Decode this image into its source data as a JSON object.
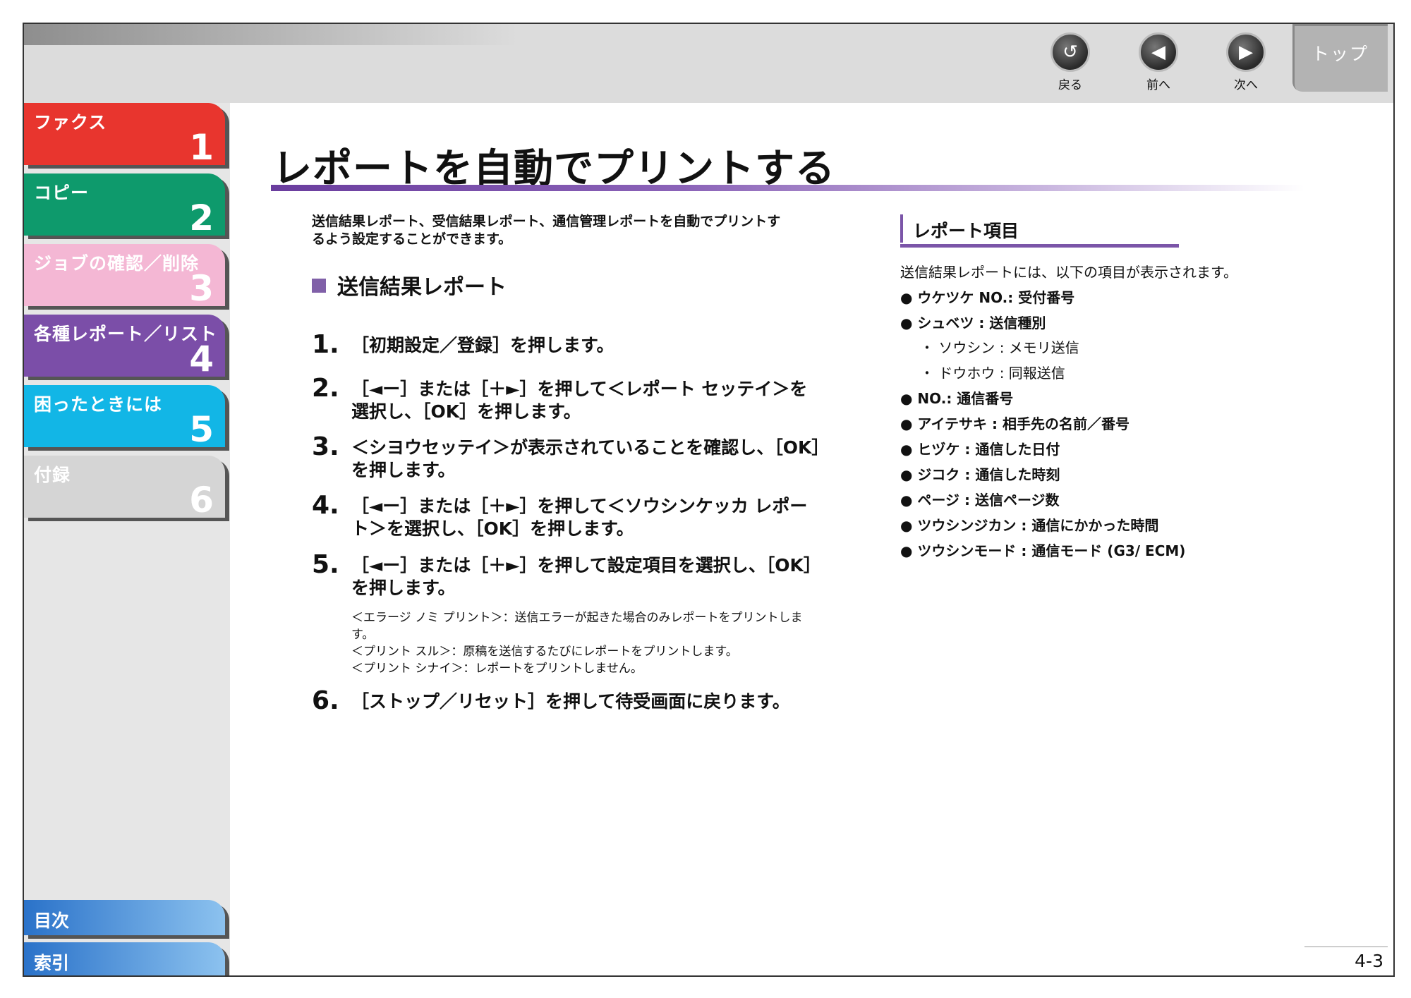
{
  "nav": {
    "back_label": "戻る",
    "prev_label": "前へ",
    "next_label": "次へ",
    "top_label": "トップ"
  },
  "sidebar": {
    "tabs": [
      {
        "label": "ファクス",
        "num": "1",
        "color": "#e8352e"
      },
      {
        "label": "コピー",
        "num": "2",
        "color": "#0e9a6c"
      },
      {
        "label": "ジョブの確認／削除",
        "num": "3",
        "color": "#f4b7d4"
      },
      {
        "label": "各種レポート／リスト",
        "num": "4",
        "color": "#7b4ea8"
      },
      {
        "label": "困ったときには",
        "num": "5",
        "color": "#12b6e6"
      },
      {
        "label": "付録",
        "num": "6",
        "color": "#d5d5d5"
      }
    ],
    "contents_label": "目次",
    "index_label": "索引"
  },
  "page": {
    "title": "レポートを自動でプリントする",
    "intro": "送信結果レポート、受信結果レポート、通信管理レポートを自動でプリントするよう設定することができます。",
    "section_title": "送信結果レポート",
    "steps": [
      {
        "num": "1.",
        "text": "［初期設定／登録］を押します。"
      },
      {
        "num": "2.",
        "text": "［◄ー］または［＋►］を押して＜レポート セッテイ＞を選択し、［OK］を押します。"
      },
      {
        "num": "3.",
        "text": "＜シヨウセッテイ＞が表示されていることを確認し、［OK］を押します。"
      },
      {
        "num": "4.",
        "text": "［◄ー］または［＋►］を押して＜ソウシンケッカ レポート＞を選択し、［OK］を押します。"
      },
      {
        "num": "5.",
        "text": "［◄ー］または［＋►］を押して設定項目を選択し、［OK］を押します。"
      },
      {
        "num": "6.",
        "text": "［ストップ／リセット］を押して待受画面に戻ります。"
      }
    ],
    "notes": [
      "＜エラージ ノミ プリント＞：送信エラーが起きた場合のみレポートをプリントします。",
      "＜プリント スル＞：原稿を送信するたびにレポートをプリントします。",
      "＜プリント シナイ＞：レポートをプリントしません。"
    ],
    "page_number": "4-3"
  },
  "report_items": {
    "heading": "レポート項目",
    "intro": "送信結果レポートには、以下の項目が表示されます。",
    "items": [
      "● ウケツケ NO.: 受付番号",
      "● シュベツ : 送信種別",
      "・ ソウシン : メモリ送信",
      "・ ドウホウ : 同報送信",
      "● NO.: 通信番号",
      "● アイテサキ : 相手先の名前／番号",
      "● ヒヅケ : 通信した日付",
      "● ジコク : 通信した時刻",
      "● ページ : 送信ページ数",
      "● ツウシンジカン : 通信にかかった時間",
      "● ツウシンモード : 通信モード (G3/ ECM)"
    ]
  }
}
